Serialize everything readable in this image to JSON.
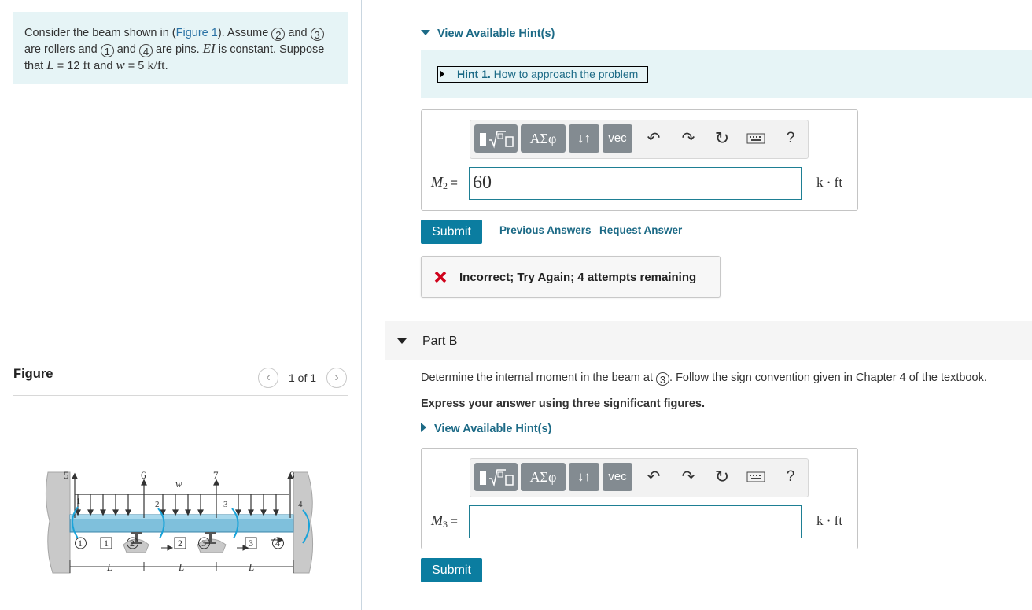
{
  "problem": {
    "s1": "Consider the beam shown in (",
    "figure_link": "Figure 1",
    "s2": "). Assume ",
    "n2": "2",
    "s3": " and ",
    "n3": "3",
    "s4": "are rollers and ",
    "n1": "1",
    "s5": " and ",
    "n4": "4",
    "s6": " are pins. ",
    "ei": "EI",
    "s7": " is constant. Suppose",
    "s8": "that ",
    "L": "L",
    "s9": " = 12 ",
    "ft": "ft",
    "s10": " and ",
    "w": "w",
    "s11": " = 5 ",
    "kft": "k/ft",
    "s12": "."
  },
  "figure": {
    "heading": "Figure",
    "pager": "1 of 1",
    "prev_icon": "chevron-left-icon",
    "next_icon": "chevron-right-icon",
    "labels": {
      "n5": "5",
      "n6": "6",
      "n7": "7",
      "n8": "8",
      "w": "w",
      "s1": "1",
      "s2": "2",
      "s3": "3",
      "s4": "4",
      "sq1": "1",
      "sq2": "2",
      "sq3": "3",
      "c1": "1",
      "c2": "2",
      "c3": "3",
      "c4": "4",
      "L1": "L",
      "L2": "L",
      "L3": "L"
    }
  },
  "partA": {
    "hint_toggle": "View Available Hint(s)",
    "hint1_bold": "Hint 1.",
    "hint1_text": " How to approach the problem",
    "toolbar": {
      "templates_icon": "templates-icon",
      "greek": "ΑΣφ",
      "arrows": "↓↑",
      "vec": "vec",
      "undo_icon": "undo-icon",
      "redo_icon": "redo-icon",
      "reset_icon": "reset-icon",
      "keyboard_icon": "keyboard-icon",
      "help": "?"
    },
    "label_var": "M",
    "label_sub": "2",
    "label_eq": " =",
    "value": "60",
    "unit": "k · ft",
    "submit": "Submit",
    "prev_answers": "Previous Answers",
    "request_answer": "Request Answer",
    "feedback_icon": "incorrect-x-icon",
    "feedback": "Incorrect; Try Again; 4 attempts remaining",
    "feedback_color": "#d0021b"
  },
  "partB": {
    "title": "Part B",
    "q1": "Determine the internal moment in the beam at ",
    "q_node": "3",
    "q2": ". Follow the sign convention given in Chapter 4 of the textbook.",
    "instruction": "Express your answer using three significant figures.",
    "hint_toggle": "View Available Hint(s)",
    "toolbar": {
      "greek": "ΑΣφ",
      "arrows": "↓↑",
      "vec": "vec",
      "help": "?"
    },
    "label_var": "M",
    "label_sub": "3",
    "label_eq": " =",
    "value": "",
    "unit": "k · ft",
    "submit": "Submit"
  },
  "colors": {
    "accent": "#0b7da0",
    "link": "#1c6a86",
    "panel": "#e6f4f6"
  }
}
